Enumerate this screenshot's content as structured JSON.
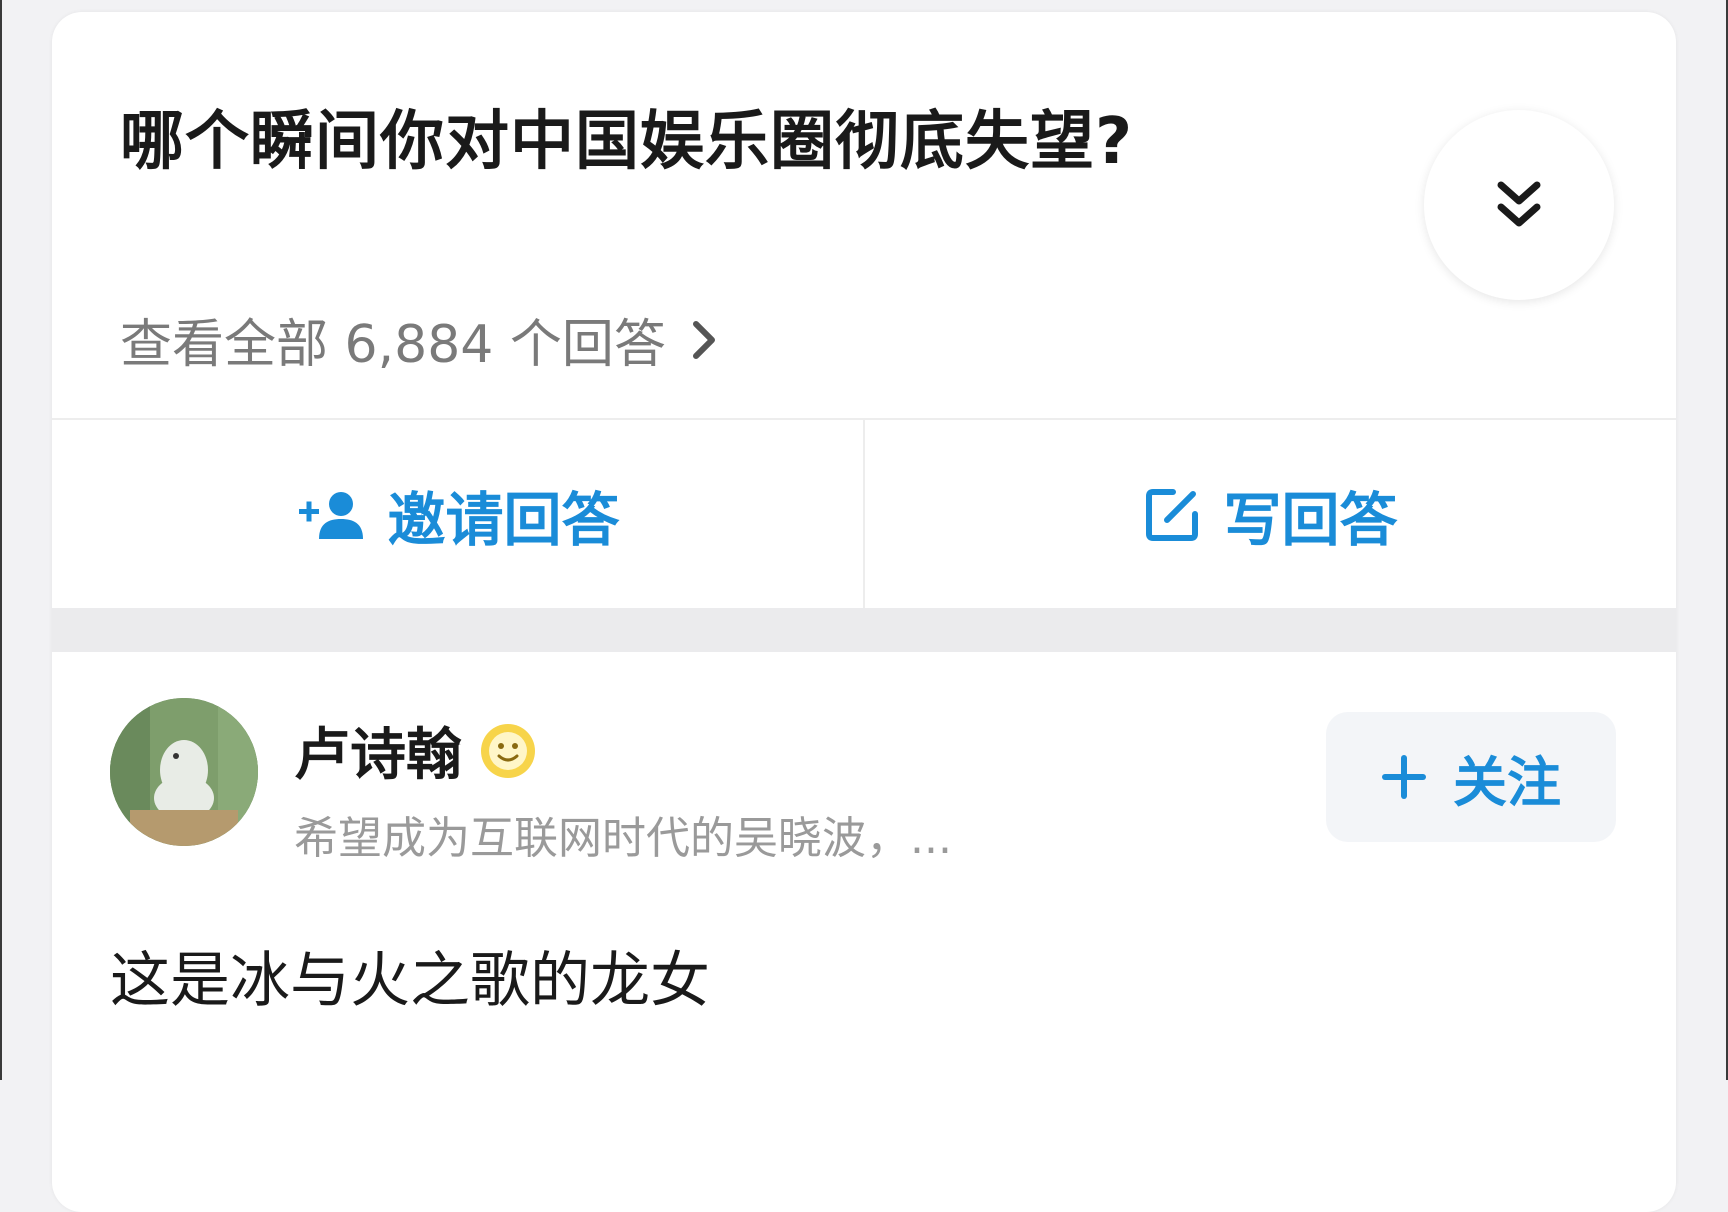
{
  "question": {
    "title": "哪个瞬间你对中国娱乐圈彻底失望?",
    "view_all": "查看全部 6,884 个回答",
    "expand_icon": "double-chevron-down-icon"
  },
  "actions": {
    "invite_label": "邀请回答",
    "invite_icon": "add-user-icon",
    "write_label": "写回答",
    "write_icon": "edit-icon"
  },
  "answer": {
    "author_name": "卢诗翰",
    "author_badge_icon": "smiley-badge-icon",
    "author_bio": "希望成为互联网时代的吴晓波，...",
    "follow_label": "关注",
    "content": "这是冰与火之歌的龙女"
  },
  "colors": {
    "accent": "#1a8cd8",
    "title": "#1a1a1a",
    "muted": "#7a7a7a"
  }
}
